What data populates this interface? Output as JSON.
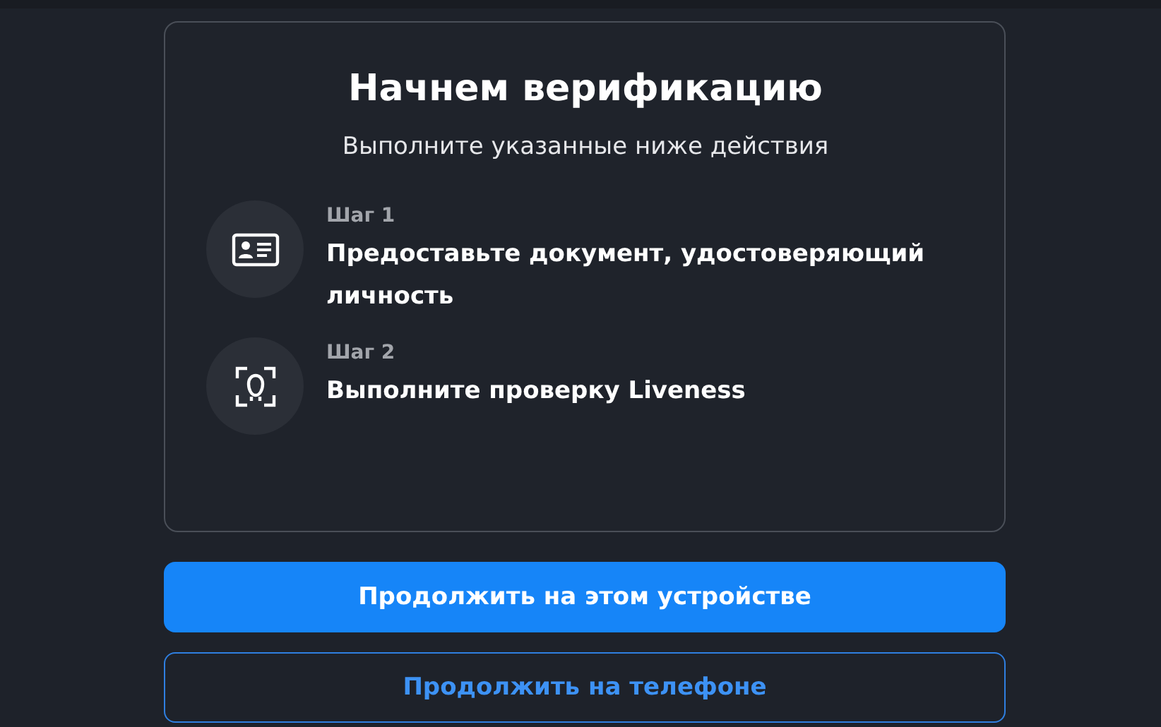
{
  "card": {
    "title": "Начнем верификацию",
    "subtitle": "Выполните указанные ниже действия",
    "steps": [
      {
        "kind": "document",
        "label": "Шаг 1",
        "text": "Предоставьте документ, удостоверяющий личность"
      },
      {
        "kind": "face",
        "label": "Шаг 2",
        "text": "Выполните проверку Liveness"
      }
    ]
  },
  "buttons": [
    {
      "kind": "primary",
      "label": "Продолжить на этом устройстве"
    },
    {
      "kind": "outline",
      "label": "Продолжить на телефоне"
    }
  ]
}
